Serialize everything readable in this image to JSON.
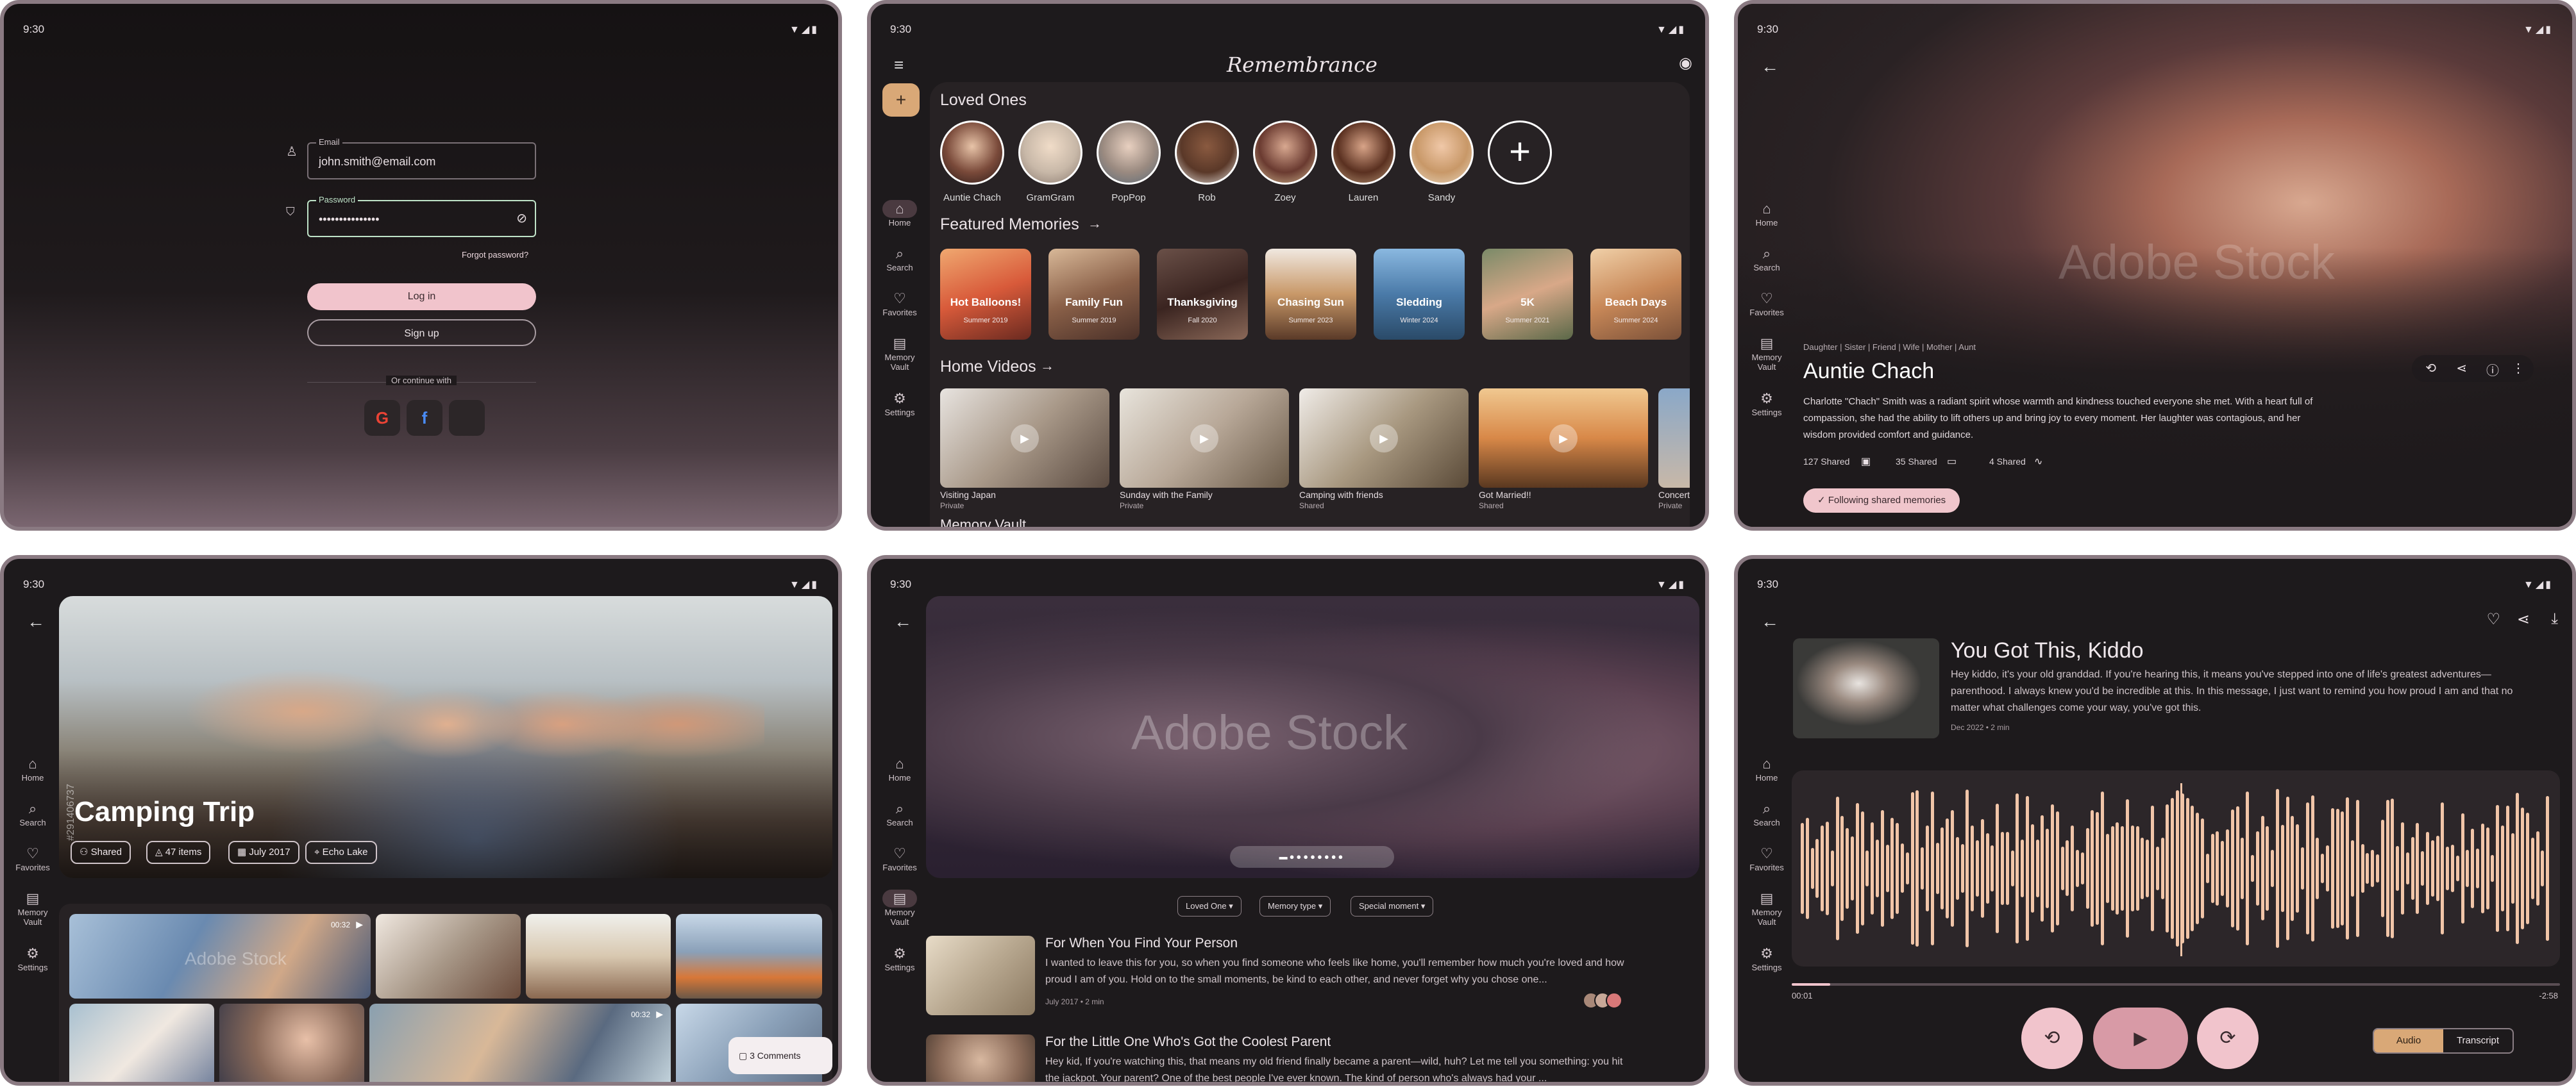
{
  "status": {
    "time": "9:30",
    "icons": "▼◢▮"
  },
  "login": {
    "email_label": "Email",
    "email_value": "john.smith@email.com",
    "password_label": "Password",
    "password_value": "•••••••••••••••",
    "forgot": "Forgot password?",
    "login_btn": "Log in",
    "signup_btn": "Sign up",
    "or": "Or continue with",
    "providers": [
      "G",
      "f",
      ""
    ]
  },
  "rail": [
    "Home",
    "Search",
    "Favorites",
    "Memory Vault",
    "Settings"
  ],
  "home": {
    "app_title": "Remembrance",
    "loved_title": "Loved Ones",
    "loved": [
      "Auntie Chach",
      "GramGram",
      "PopPop",
      "Rob",
      "Zoey",
      "Lauren",
      "Sandy"
    ],
    "featured_title": "Featured Memories",
    "featured": [
      [
        "Hot Balloons!",
        "Summer 2019"
      ],
      [
        "Family Fun",
        "Summer 2019"
      ],
      [
        "Thanksgiving",
        "Fall 2020"
      ],
      [
        "Chasing Sun",
        "Summer 2023"
      ],
      [
        "Sledding",
        "Winter 2024"
      ],
      [
        "5K",
        "Summer 2021"
      ],
      [
        "Beach Days",
        "Summer 2024"
      ]
    ],
    "videos_title": "Home Videos",
    "videos": [
      [
        "Visiting Japan",
        "Private"
      ],
      [
        "Sunday with the Family",
        "Private"
      ],
      [
        "Camping with friends",
        "Shared"
      ],
      [
        "Got Married!!",
        "Shared"
      ],
      [
        "Concert",
        "Private"
      ]
    ],
    "vault_title": "Memory Vault"
  },
  "profile": {
    "watermark": "Adobe Stock",
    "tags": "Daughter | Sister | Friend | Wife | Mother | Aunt",
    "name": "Auntie Chach",
    "bio": "Charlotte \"Chach\" Smith was a radiant spirit whose warmth and kindness touched everyone she met. With a heart full of compassion, she had the ability to lift others up and bring joy to every moment. Her laughter was contagious, and her wisdom provided comfort and guidance.",
    "stats": [
      "127 Shared",
      "35 Shared",
      "4 Shared"
    ],
    "follow": "Following shared memories"
  },
  "album": {
    "title": "Camping Trip",
    "pills": [
      "Shared",
      "47 items",
      "July 2017",
      "Echo Lake"
    ],
    "duration1": "00:32",
    "duration2": "00:32",
    "comments": "3 Comments",
    "watermark": "Adobe Stock",
    "side_id": "#291406737"
  },
  "vault": {
    "watermark": "Adobe Stock",
    "filters": [
      "Loved One",
      "Memory type",
      "Special moment"
    ],
    "items": [
      {
        "title": "For When You Find Your Person",
        "desc": "I wanted to leave this for you, so when you find someone who feels like home, you'll remember how much you're loved and how proud I am of you. Hold on to the small moments, be kind to each other, and never forget why you chose one...",
        "meta": "July 2017 • 2 min"
      },
      {
        "title": "For the Little One Who's Got the Coolest Parent",
        "desc": "Hey kid, If you're watching this, that means my old friend finally became a parent—wild, huh? Let me tell you something: you hit the jackpot. Your parent? One of the best people I've ever known. The kind of person who's always had your ...",
        "meta": ""
      }
    ]
  },
  "audio": {
    "title": "You Got This, Kiddo",
    "desc": "Hey kiddo, it's your old granddad. If you're hearing this, it means you've stepped into one of life's greatest adventures—parenthood. I always knew you'd be incredible at this. In this message, I just want to remind you how proud I am and that no matter what challenges come your way, you've got this.",
    "meta": "Dec 2022 • 2 min",
    "elapsed": "00:01",
    "remaining": "-2:58",
    "progress": 0.05,
    "tabs": [
      "Audio",
      "Transcript"
    ]
  },
  "colors": {
    "accent": "#f0c6cc",
    "surface": "#272224",
    "bg": "#1d1a1c",
    "wave": "#f1c5a8"
  }
}
